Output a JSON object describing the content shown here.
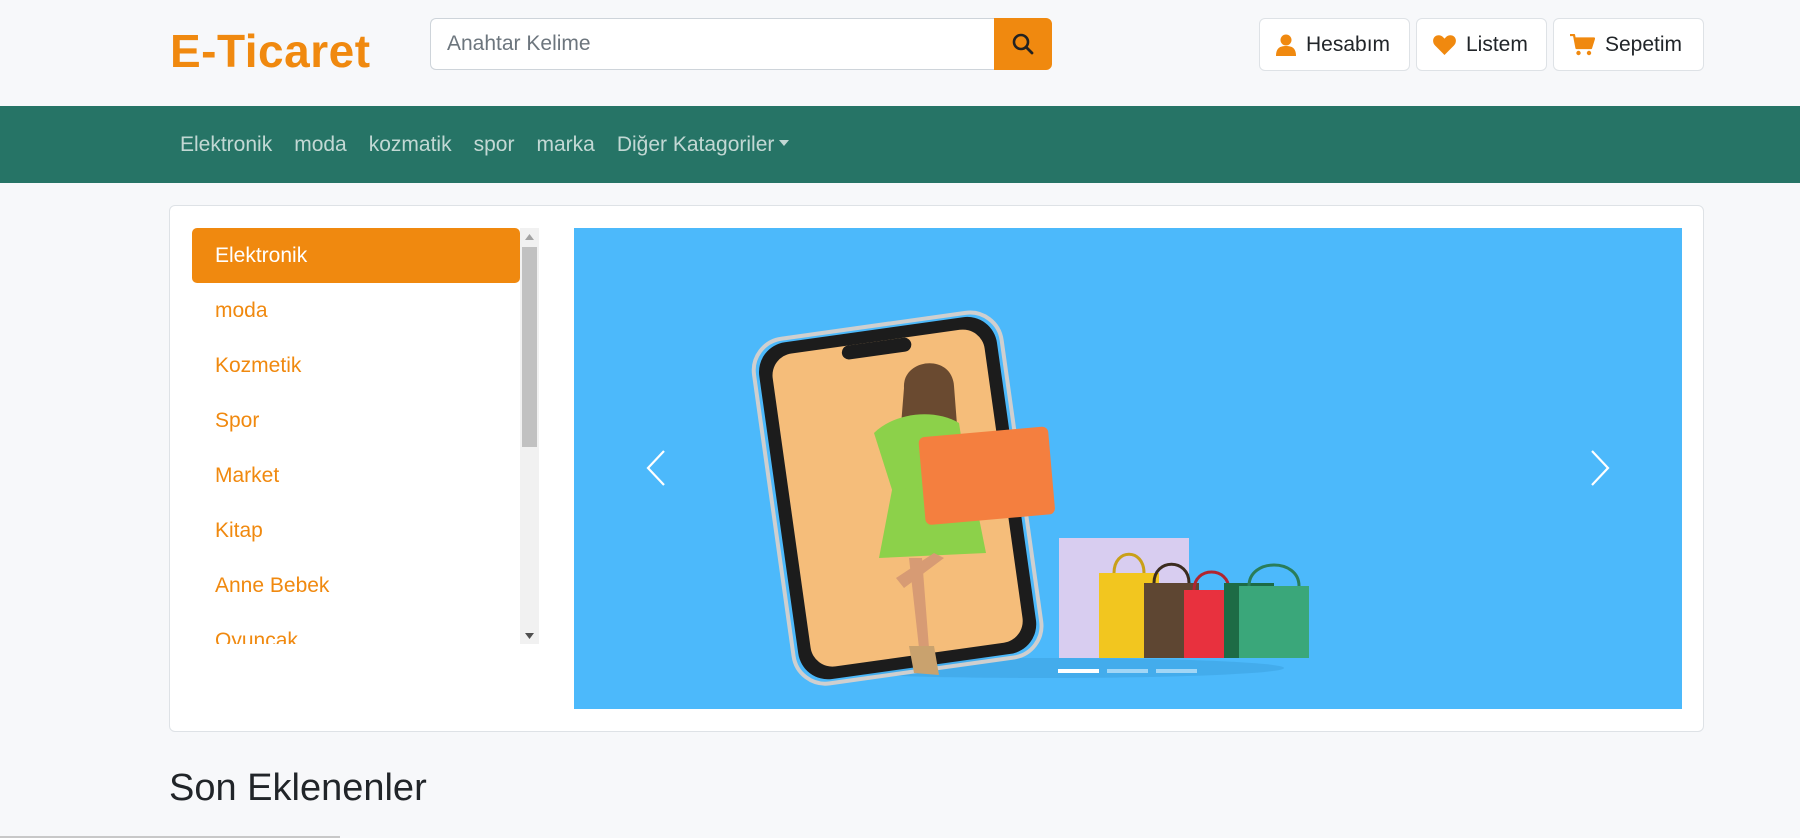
{
  "header": {
    "brand": "E-Ticaret",
    "search_placeholder": "Anahtar Kelime",
    "account_label": "Hesabım",
    "wishlist_label": "Listem",
    "cart_label": "Sepetim"
  },
  "navbar": {
    "links": [
      "Elektronik",
      "moda",
      "kozmatik",
      "spor",
      "marka"
    ],
    "dropdown_label": "Diğer Katagoriler"
  },
  "categories": [
    "Elektronik",
    "moda",
    "Kozmetik",
    "Spor",
    "Market",
    "Kitap",
    "Anne Bebek",
    "Oyuncak"
  ],
  "carousel": {
    "slide_count": 3,
    "active_slide": 1
  },
  "section": {
    "title": "Son Eklenenler"
  },
  "colors": {
    "accent": "#f0890f",
    "navbar": "#267466",
    "carousel_bg": "#4cb9fb"
  }
}
